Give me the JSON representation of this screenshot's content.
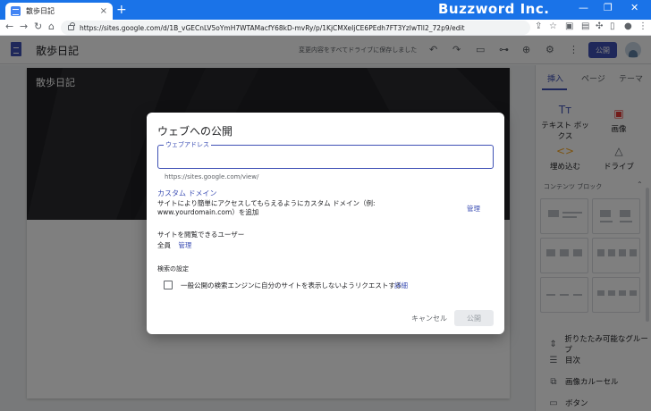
{
  "browser": {
    "tab_title": "散歩日記",
    "tab_close": "×",
    "new_tab": "+",
    "brand": "Buzzword Inc.",
    "url": "https://sites.google.com/d/1B_vGECnLV5oYmH7WTAMacfY68kD-mvRy/p/1KjCMXeIjCE6PEdh7FT3YzIwTlI2_72p9/edit"
  },
  "sites_header": {
    "title": "散歩日記",
    "save_status": "変更内容をすべてドライブに保存しました",
    "publish_label": "公開"
  },
  "page": {
    "banner_title": "散歩日記"
  },
  "right_panel": {
    "tabs": [
      "挿入",
      "ページ",
      "テーマ"
    ],
    "tools": [
      {
        "label": "テキスト ボックス",
        "icon": "text-box-icon"
      },
      {
        "label": "画像",
        "icon": "image-icon"
      },
      {
        "label": "埋め込む",
        "icon": "embed-icon"
      },
      {
        "label": "ドライブ",
        "icon": "drive-icon"
      }
    ],
    "section_label": "コンテンツ ブロック",
    "list_items": [
      "折りたたみ可能なグループ",
      "目次",
      "画像カルーセル",
      "ボタン"
    ]
  },
  "dialog": {
    "title": "ウェブへの公開",
    "web_address_label": "ウェブアドレス",
    "web_address_value": "",
    "url_prefix": "https://sites.google.com/view/",
    "custom_domain_title": "カスタム ドメイン",
    "custom_domain_desc": "サイトにより簡単にアクセスしてもらえるようにカスタム ドメイン（例: www.yourdomain.com）を追加",
    "manage_label": "管理",
    "viewers_title": "サイトを閲覧できるユーザー",
    "viewers_value": "全員",
    "viewers_manage": "管理",
    "search_title": "検索の設定",
    "search_option": "一般公開の検索エンジンに自分のサイトを表示しないようリクエストする",
    "details_label": "詳細",
    "cancel_label": "キャンセル",
    "publish_label": "公開"
  },
  "colors": {
    "accent": "#3f51b5",
    "chrome_blue": "#1a73e8"
  }
}
